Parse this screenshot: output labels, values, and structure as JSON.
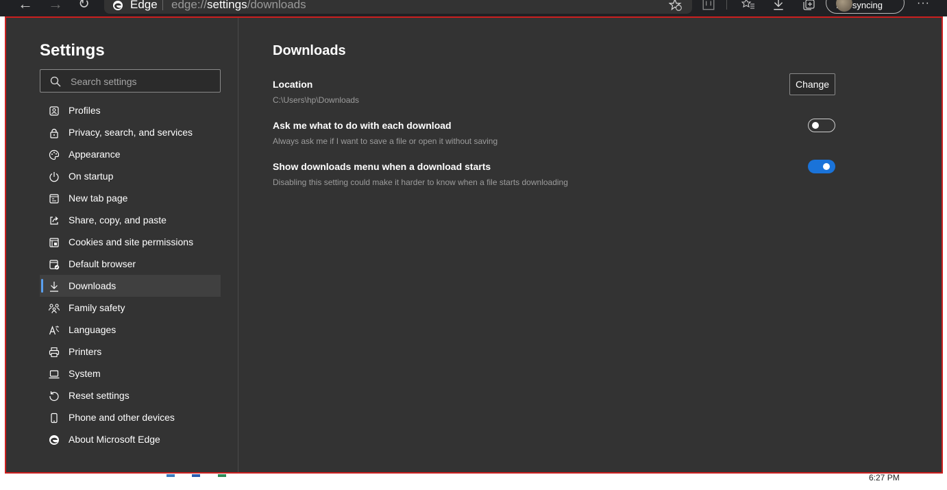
{
  "browser": {
    "app_name": "Edge",
    "url_prefix": "edge://",
    "url_host": "settings",
    "url_path": "/downloads",
    "sync_label": "Not syncing",
    "more_label": "···"
  },
  "sidebar": {
    "title": "Settings",
    "search_placeholder": "Search settings",
    "items": [
      {
        "label": "Profiles",
        "icon": "profile-icon"
      },
      {
        "label": "Privacy, search, and services",
        "icon": "lock-icon"
      },
      {
        "label": "Appearance",
        "icon": "palette-icon"
      },
      {
        "label": "On startup",
        "icon": "power-icon"
      },
      {
        "label": "New tab page",
        "icon": "newtab-icon"
      },
      {
        "label": "Share, copy, and paste",
        "icon": "share-icon"
      },
      {
        "label": "Cookies and site permissions",
        "icon": "cookies-icon"
      },
      {
        "label": "Default browser",
        "icon": "default-browser-icon"
      },
      {
        "label": "Downloads",
        "icon": "download-icon",
        "active": true
      },
      {
        "label": "Family safety",
        "icon": "family-icon"
      },
      {
        "label": "Languages",
        "icon": "languages-icon"
      },
      {
        "label": "Printers",
        "icon": "printer-icon"
      },
      {
        "label": "System",
        "icon": "laptop-icon"
      },
      {
        "label": "Reset settings",
        "icon": "reset-icon"
      },
      {
        "label": "Phone and other devices",
        "icon": "phone-icon"
      },
      {
        "label": "About Microsoft Edge",
        "icon": "edge-icon"
      }
    ]
  },
  "main": {
    "heading": "Downloads",
    "location": {
      "title": "Location",
      "path": "C:\\Users\\hp\\Downloads",
      "button_label": "Change"
    },
    "ask_each": {
      "title": "Ask me what to do with each download",
      "description": "Always ask me if I want to save a file or open it without saving",
      "enabled": false
    },
    "show_menu": {
      "title": "Show downloads menu when a download starts",
      "description": "Disabling this setting could make it harder to know when a file starts downloading",
      "enabled": true
    }
  },
  "taskbar": {
    "clock": "6:27 PM"
  },
  "colors": {
    "background": "#333333",
    "accent": "#1a73d9",
    "active_indicator": "#5aa0ef",
    "frame_border": "#cc1f1f"
  }
}
